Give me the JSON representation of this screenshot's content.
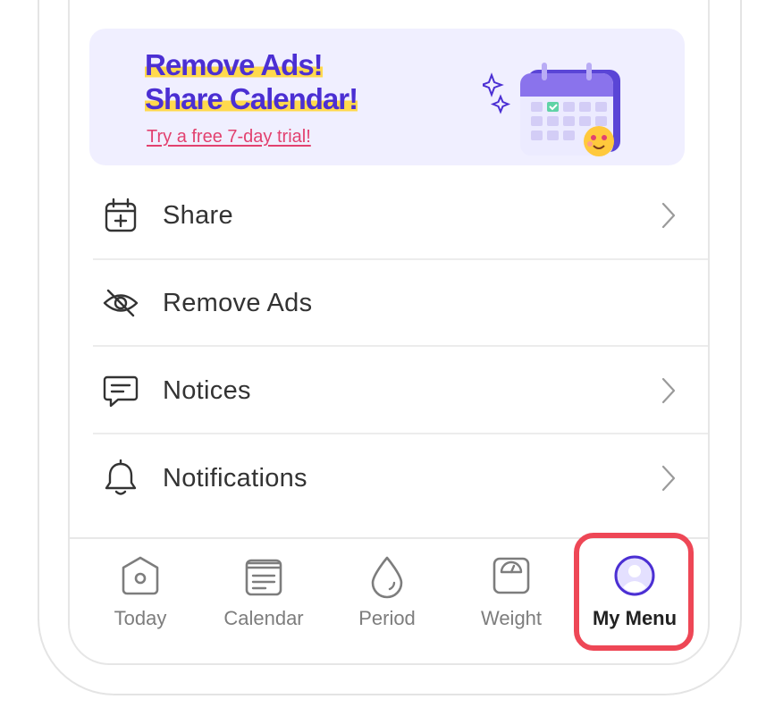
{
  "promo": {
    "headline_1": "Remove Ads!",
    "headline_2": "Share Calendar!",
    "trial_link": "Try a free 7-day trial!",
    "art_icon": "calendar-emoji-illustration"
  },
  "menu": {
    "items": [
      {
        "label": "Share",
        "icon": "calendar-plus-icon",
        "has_chevron": true
      },
      {
        "label": "Remove Ads",
        "icon": "eye-off-icon",
        "has_chevron": false
      },
      {
        "label": "Notices",
        "icon": "message-square-icon",
        "has_chevron": true
      },
      {
        "label": "Notifications",
        "icon": "bell-icon",
        "has_chevron": true
      }
    ]
  },
  "tabbar": {
    "tabs": [
      {
        "label": "Today",
        "icon": "home-icon"
      },
      {
        "label": "Calendar",
        "icon": "calendar-icon"
      },
      {
        "label": "Period",
        "icon": "drop-icon"
      },
      {
        "label": "Weight",
        "icon": "scale-icon"
      },
      {
        "label": "My Menu",
        "icon": "profile-avatar-icon",
        "active": true
      }
    ]
  },
  "colors": {
    "accent_purple": "#4b2fd3",
    "highlight_yellow": "#ffd94d",
    "trial_pink": "#e2416f",
    "promo_bg": "#f0efff",
    "selection_red": "#ee4756"
  }
}
